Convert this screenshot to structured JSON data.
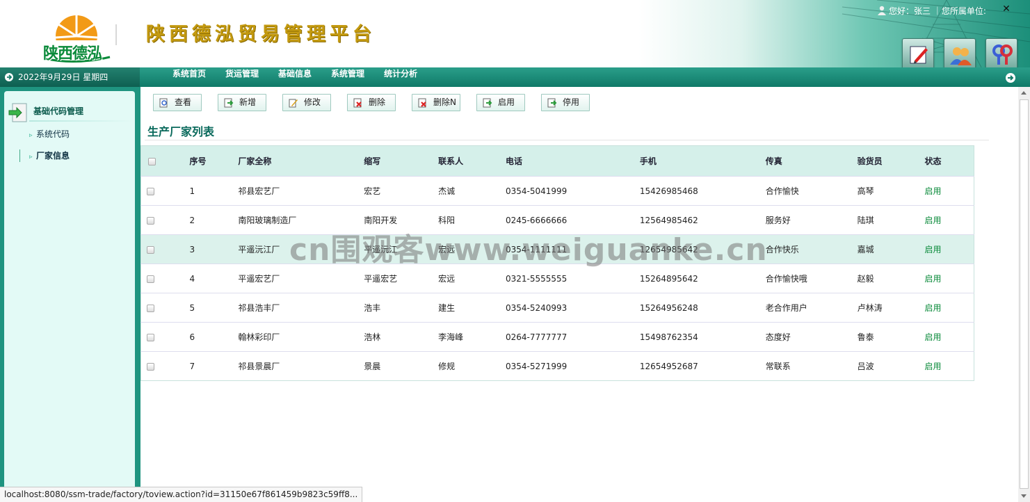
{
  "header": {
    "logo_text": "陕西德泓",
    "site_title": "陕西德泓贸易管理平台",
    "user_info": "您好：张三 ｜您所属单位:",
    "close_glyph": "✕"
  },
  "navbar": {
    "date": "2022年9月29日 星期四",
    "menu": [
      "系统首页",
      "货运管理",
      "基础信息",
      "系统管理",
      "统计分析"
    ]
  },
  "sidebar": {
    "section_title": "基础代码管理",
    "items": [
      "系统代码",
      "厂家信息"
    ]
  },
  "toolbar": {
    "buttons": [
      "查看",
      "新增",
      "修改",
      "删除",
      "删除N",
      "启用",
      "停用"
    ]
  },
  "list": {
    "title": "生产厂家列表",
    "columns": [
      "序号",
      "厂家全称",
      "缩写",
      "联系人",
      "电话",
      "手机",
      "传真",
      "验货员",
      "状态"
    ],
    "rows": [
      [
        "1",
        "祁县宏艺厂",
        "宏艺",
        "杰诚",
        "0354-5041999",
        "15426985468",
        "合作愉快",
        "高琴",
        "启用"
      ],
      [
        "2",
        "南阳玻璃制造厂",
        "南阳开发",
        "科阳",
        "0245-6666666",
        "12564985462",
        "服务好",
        "陆琪",
        "启用"
      ],
      [
        "3",
        "平遥沅江厂",
        "平遥沅江",
        "宏远",
        "0354-1111111",
        "12654985642",
        "合作快乐",
        "嘉城",
        "启用"
      ],
      [
        "4",
        "平遥宏艺厂",
        "平遥宏艺",
        "宏远",
        "0321-5555555",
        "15264895642",
        "合作愉快哦",
        "赵毅",
        "启用"
      ],
      [
        "5",
        "祁县浩丰厂",
        "浩丰",
        "建生",
        "0354-5240993",
        "15264956248",
        "老合作用户",
        "卢林涛",
        "启用"
      ],
      [
        "6",
        "翰林彩印厂",
        "浩林",
        "李海峰",
        "0264-7777777",
        "15498762354",
        "态度好",
        "鲁泰",
        "启用"
      ],
      [
        "7",
        "祁县景晨厂",
        "景晨",
        "修规",
        "0354-5271999",
        "12654952687",
        "常联系",
        "吕波",
        "启用"
      ]
    ]
  },
  "watermark": "cn围观客www.weiguanke.cn",
  "statusbar": {
    "url": "localhost:8080/ssm-trade/factory/toview.action?id=31150e67f861459b9823c59ff8..."
  }
}
